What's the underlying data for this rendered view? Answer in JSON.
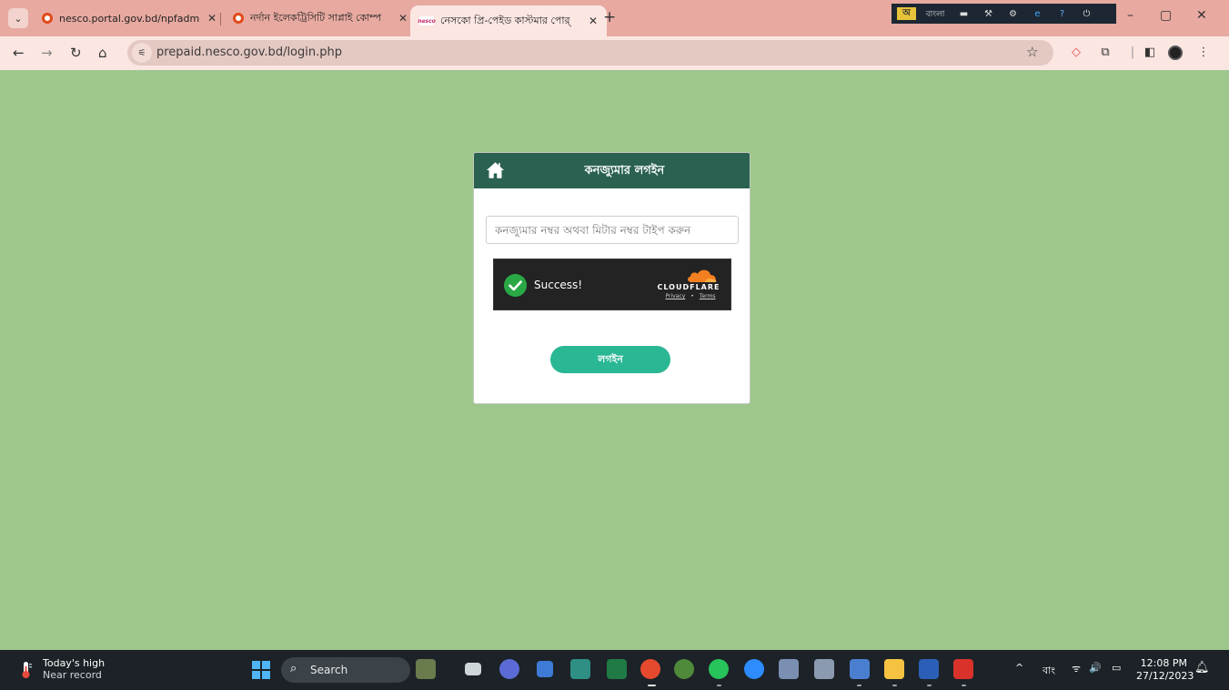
{
  "browser": {
    "tabs": [
      {
        "title": "nesco.portal.gov.bd/npfadmin/",
        "active": false
      },
      {
        "title": "নর্দান ইলেকট্রিসিটি সাপ্লাই কোম্প",
        "active": false
      },
      {
        "title": "নেসকো প্রি-পেইড কাস্টমার পোর্",
        "active": true
      }
    ],
    "tab_close_glyph": "✕",
    "new_tab_glyph": "+",
    "url": "prepaid.nesco.gov.bd/login.php",
    "tray_lang": "বাংলা",
    "window_controls": [
      "–",
      "▢",
      "✕"
    ]
  },
  "login": {
    "title": "কনজ্যুমার লগইন",
    "input_placeholder": "কনজ্যুমার নম্বর অথবা মিটার নম্বর টাইপ করুন",
    "button_label": "লগইন",
    "captcha": {
      "status": "Success!",
      "brand": "CLOUDFLARE",
      "privacy": "Privacy",
      "separator": "•",
      "terms": "Terms"
    }
  },
  "taskbar": {
    "weather_title": "Today's high",
    "weather_subtitle": "Near record",
    "search_label": "Search",
    "input_lang": "বাং",
    "time": "12:08 PM",
    "date": "27/12/2023"
  },
  "colors": {
    "page_bg": "#9dc78b",
    "card_header": "#2a6151",
    "login_button": "#2ab793",
    "tab_strip": "#e7a9a0",
    "taskbar": "#1c2227"
  }
}
